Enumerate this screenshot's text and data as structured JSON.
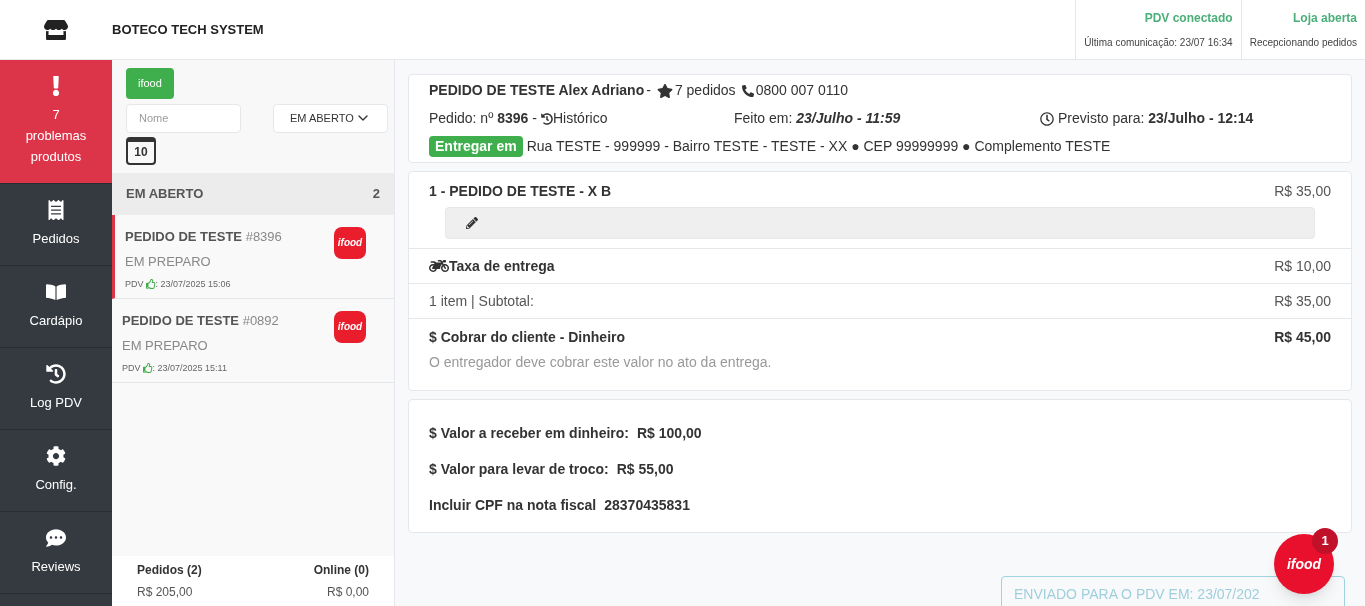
{
  "header": {
    "title": "BOTECO TECH SYSTEM",
    "status": [
      {
        "title": "PDV conectado",
        "subtitle": "Última comunicação: 23/07 16:34"
      },
      {
        "title": "Loja aberta",
        "subtitle": "Recepcionando pedidos"
      }
    ]
  },
  "sidebar": {
    "items": [
      {
        "kind": "alert",
        "label": "7\nproblemas\nprodutos"
      },
      {
        "kind": "orders",
        "label": "Pedidos"
      },
      {
        "kind": "menu",
        "label": "Cardápio"
      },
      {
        "kind": "log",
        "label": "Log PDV"
      },
      {
        "kind": "config",
        "label": "Config."
      },
      {
        "kind": "reviews",
        "label": "Reviews"
      }
    ]
  },
  "orders_panel": {
    "filter_button": "ifood",
    "name_field": {
      "placeholder": "Nome"
    },
    "status_select": "EM ABERTO",
    "calendar_day": "10",
    "group": {
      "title": "EM ABERTO",
      "count": "2"
    },
    "orders": [
      {
        "title": "PEDIDO DE TESTE",
        "number": "#8396",
        "status": "EM PREPARO",
        "pdv_label": "PDV",
        "time": ": 23/07/2025 15:06",
        "logo": "ifood",
        "selected": true
      },
      {
        "title": "PEDIDO DE TESTE",
        "number": "#0892",
        "status": "EM PREPARO",
        "pdv_label": "PDV",
        "time": ": 23/07/2025 15:11",
        "logo": "ifood",
        "selected": false
      }
    ],
    "footer": [
      {
        "label": "Pedidos (2)",
        "value": "R$ 205,00"
      },
      {
        "label": "Online (0)",
        "value": "R$ 0,00"
      }
    ]
  },
  "order": {
    "customer": "PEDIDO DE TESTE Alex Adriano",
    "sep1": "-",
    "orders_count": "7 pedidos",
    "phone": "0800 007 0110",
    "number_label": "Pedido: nº",
    "number": "8396",
    "sep2": "-",
    "history": "Histórico",
    "made_label": "Feito em:",
    "made": "23/Julho - 11:59",
    "expected_label": "Previsto para:",
    "expected": "23/Julho - 12:14",
    "delivery_badge": "Entregar em",
    "address": "Rua TESTE - 999999 - Bairro TESTE - TESTE - XX ● CEP 99999999 ● Complemento TESTE",
    "item": {
      "name": "1 - PEDIDO DE TESTE - X B",
      "price": "R$ 35,00"
    },
    "fee": {
      "label": "Taxa de entrega",
      "value": "R$ 10,00"
    },
    "subtotal": {
      "label": "1 item | Subtotal:",
      "value": "R$ 35,00"
    },
    "charge": {
      "label": "$ Cobrar do cliente - Dinheiro",
      "value": "R$ 45,00",
      "note": "O entregador deve cobrar este valor no ato da entrega."
    },
    "payment": [
      {
        "label": "$ Valor a receber em dinheiro:",
        "value": "R$ 100,00"
      },
      {
        "label": "$ Valor para levar de troco:",
        "value": "R$ 55,00"
      },
      {
        "label": "Incluir CPF na nota fiscal",
        "value": "28370435831"
      }
    ],
    "sent_button": "ENVIADO PARA O PDV EM: 23/07/202"
  },
  "chat_bubble": {
    "brand": "ifood",
    "badge": "1"
  }
}
